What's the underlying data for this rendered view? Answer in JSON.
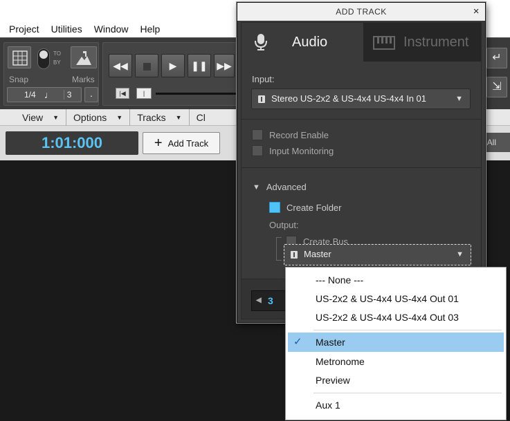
{
  "menubar": {
    "items": [
      "Project",
      "Utilities",
      "Window",
      "Help"
    ]
  },
  "toolbar": {
    "snap_label": "Snap",
    "marks_label": "Marks",
    "snap_to_top": "TO",
    "snap_to_bottom": "BY",
    "quantize_value": "1/4",
    "quantize_note": "♩",
    "quantize_tuplet": "3",
    "quantize_dot": "."
  },
  "subbar": {
    "items": [
      {
        "label": "View"
      },
      {
        "label": "Options"
      },
      {
        "label": "Tracks"
      },
      {
        "label": "Cl"
      }
    ]
  },
  "timebar": {
    "time": "1:01:000",
    "add_track": "Add Track",
    "all": "All"
  },
  "dialog": {
    "title": "ADD TRACK",
    "close": "×",
    "tabs": {
      "audio": "Audio",
      "instrument": "Instrument"
    },
    "input_label": "Input:",
    "input_value": "Stereo US-2x2 & US-4x4 US-4x4 In 01",
    "record_enable": "Record Enable",
    "input_monitoring": "Input Monitoring",
    "advanced": "Advanced",
    "create_folder": "Create Folder",
    "output_label": "Output:",
    "create_bus": "Create Bus",
    "output_value": "Master",
    "track_count": "3"
  },
  "dropdown": {
    "items": [
      {
        "label": "--- None ---",
        "selected": false
      },
      {
        "label": "US-2x2 & US-4x4 US-4x4 Out 01",
        "selected": false
      },
      {
        "label": "US-2x2 & US-4x4 US-4x4 Out 03",
        "selected": false
      },
      {
        "label": "Master",
        "selected": true
      },
      {
        "label": "Metronome",
        "selected": false
      },
      {
        "label": "Preview",
        "selected": false
      },
      {
        "label": "Aux 1",
        "selected": false
      }
    ]
  },
  "colors": {
    "accent": "#4fc3f7",
    "selection": "#99ccf0",
    "dark_bg": "#2b2b2b"
  }
}
